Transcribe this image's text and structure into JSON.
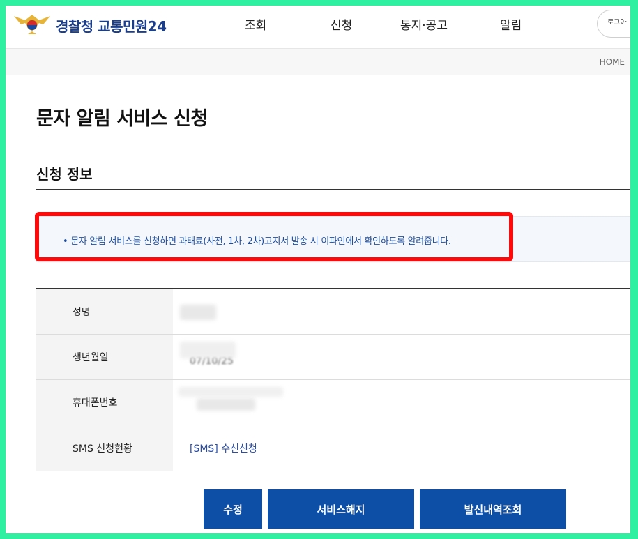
{
  "header": {
    "logo_text": "경찰청 교통민원24",
    "nav": [
      "조회",
      "신청",
      "통지·공고",
      "알림"
    ],
    "login_label": "로그아"
  },
  "breadcrumb": "HOME",
  "page_title": "문자 알림 서비스 신청",
  "section_title": "신청 정보",
  "notice": "• 문자 알림 서비스를 신청하면 과태료(사전, 1차, 2차)고지서 발송 시 이파인에서 확인하도록 알려줍니다.",
  "table": {
    "rows": [
      {
        "label": "성명",
        "value": ""
      },
      {
        "label": "생년월일",
        "value": "07/10/25"
      },
      {
        "label": "휴대폰번호",
        "value": ""
      },
      {
        "label": "SMS 신청현황",
        "value": "[SMS] 수신신청"
      }
    ]
  },
  "buttons": {
    "edit": "수정",
    "cancel_service": "서비스해지",
    "history": "발신내역조회"
  },
  "colors": {
    "frame": "#2ef0a0",
    "highlight": "#ff0a0a",
    "button": "#0d4fa6",
    "notice_text": "#1d4ea0"
  }
}
